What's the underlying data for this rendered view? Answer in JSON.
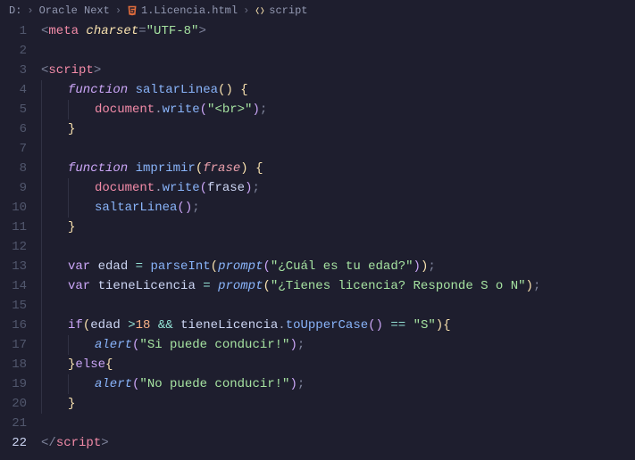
{
  "breadcrumb": {
    "drive": "D:",
    "folder": "Oracle Next",
    "file": "1.Licencia.html",
    "symbol": "script"
  },
  "lines": {
    "count": 22,
    "active": 22
  },
  "code": {
    "meta_charset": "\"UTF-8\"",
    "tag_meta": "meta",
    "attr_charset": "charset",
    "tag_script": "script",
    "kw_function": "function",
    "kw_var": "var",
    "kw_if": "if",
    "kw_else": "else",
    "fn_saltarLinea": "saltarLinea",
    "fn_imprimir": "imprimir",
    "fn_write": "write",
    "fn_parseInt": "parseInt",
    "fn_prompt": "prompt",
    "fn_toUpperCase": "toUpperCase",
    "fn_alert": "alert",
    "obj_document": "document",
    "param_frase": "frase",
    "var_edad": "edad",
    "var_tieneLicencia": "tieneLicencia",
    "str_br": "\"<br>\"",
    "str_edad_prompt": "\"¿Cuál es tu edad?\"",
    "str_lic_prompt": "\"¿Tienes licencia? Responde S o N\"",
    "str_S": "\"S\"",
    "str_si_puede": "\"Si puede conducir!\"",
    "str_no_puede": "\"No puede conducir!\"",
    "num_18": "18",
    "op_gt": ">",
    "op_and": "&&",
    "op_eq": "==",
    "op_assign": "="
  }
}
